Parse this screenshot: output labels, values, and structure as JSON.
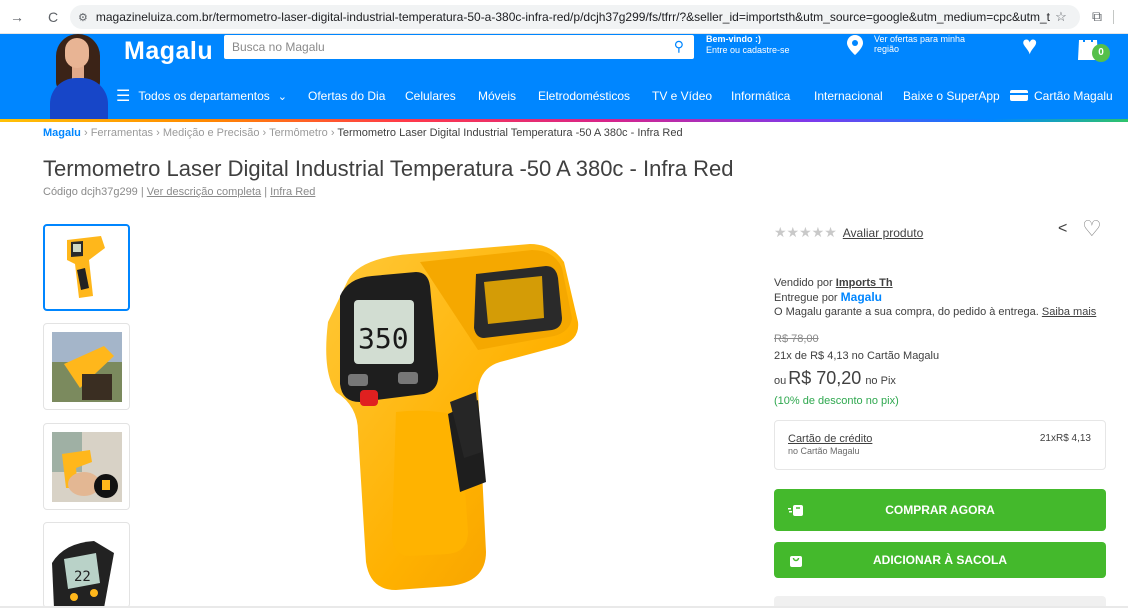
{
  "browser": {
    "back": "→",
    "reload": "C",
    "url": "magazineluiza.com.br/termometro-laser-digital-industrial-temperatura-50-a-380c-infra-red/p/dcjh37g299/fs/tfrr/?&seller_id=importsth&utm_source=google&utm_medium=cpc&utm_term=8..."
  },
  "header": {
    "logo": "Magalu",
    "search_placeholder": "Busca no Magalu",
    "welcome_line1": "Bem-vindo :)",
    "welcome_line2": "Entre ou cadastre-se",
    "offers_text": "Ver ofertas para minha região",
    "cart_count": "0",
    "brand_color": "#0086ff"
  },
  "nav": {
    "departments": "Todos os departamentos",
    "items": [
      "Ofertas do Dia",
      "Celulares",
      "Móveis",
      "Eletrodomésticos",
      "TV e Vídeo",
      "Informática",
      "Internacional",
      "Baixe o SuperApp",
      "Cartão Magalu"
    ]
  },
  "breadcrumb": {
    "logo": "Magalu",
    "items": [
      "Ferramentas",
      "Medição e Precisão",
      "Termômetro"
    ],
    "current": "Termometro Laser Digital Industrial Temperatura -50 A 380c - Infra Red"
  },
  "product": {
    "title": "Termometro Laser Digital Industrial Temperatura -50 A 380c - Infra Red",
    "code": "Código dcjh37g299",
    "see_description": "Ver descrição completa",
    "brand": "Infra Red",
    "rating_link": "Avaliar produto",
    "stars": "★★★★★",
    "display_reading": "350"
  },
  "offer": {
    "sold_by_label": "Vendido por",
    "seller": "Imports Th",
    "delivered_by_label": "Entregue por",
    "delivered_by": "Magalu",
    "guarantee": "O Magalu garante a sua compra, do pedido à entrega.",
    "learn_more": "Saiba mais",
    "old_price": "R$ 78,00",
    "installment": "21x de R$ 4,13 no Cartão Magalu",
    "pix_prefix": "ou",
    "price": "R$ 70,20",
    "pix_suffix": "no Pix",
    "discount": "(10% de desconto no pix)",
    "card_title": "Cartão de crédito",
    "card_sub": "no Cartão Magalu",
    "card_value": "21xR$ 4,13",
    "buy_now": "COMPRAR AGORA",
    "add_to_bag": "ADICIONAR À SACOLA",
    "button_color": "#44b92c"
  }
}
